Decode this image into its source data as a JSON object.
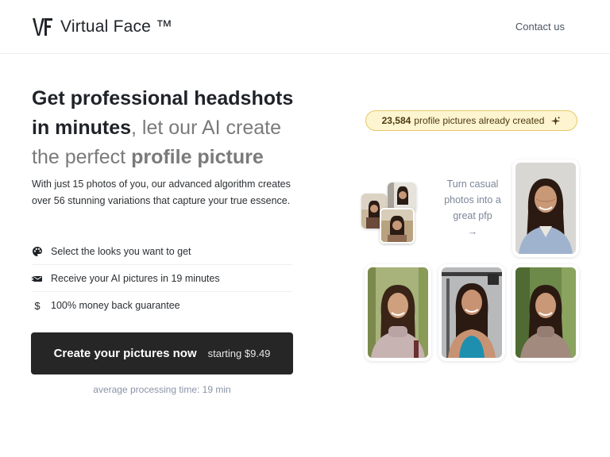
{
  "header": {
    "brand": "Virtual Face ™",
    "contact_label": "Contact us"
  },
  "hero": {
    "title_bold_1": "Get professional headshots in minutes",
    "title_light_1": ", let our AI create the perfect ",
    "title_bold_2": "profile picture",
    "description": "With just 15 photos of you, our advanced algorithm creates over 56 stunning variations that capture your true essence."
  },
  "features": [
    {
      "icon": "palette-icon",
      "label": "Select the looks you want to get"
    },
    {
      "icon": "fast-delivery-icon",
      "label": "Receive your AI pictures in 19 minutes"
    },
    {
      "icon": "dollar-icon",
      "label": "100% money back guarantee"
    }
  ],
  "cta": {
    "main_label": "Create your pictures now",
    "price_label": "starting $9.49"
  },
  "processing_note": "average processing time: 19 min",
  "badge": {
    "count": "23,584",
    "text": "profile pictures already created"
  },
  "casual_caption": "Turn casual photos into a great pfp",
  "casual_arrow": "→",
  "colors": {
    "primary_dark": "#262626",
    "badge_bg": "#fdf4d0",
    "badge_border": "#e6c96a",
    "muted_text": "#8a93a6"
  }
}
